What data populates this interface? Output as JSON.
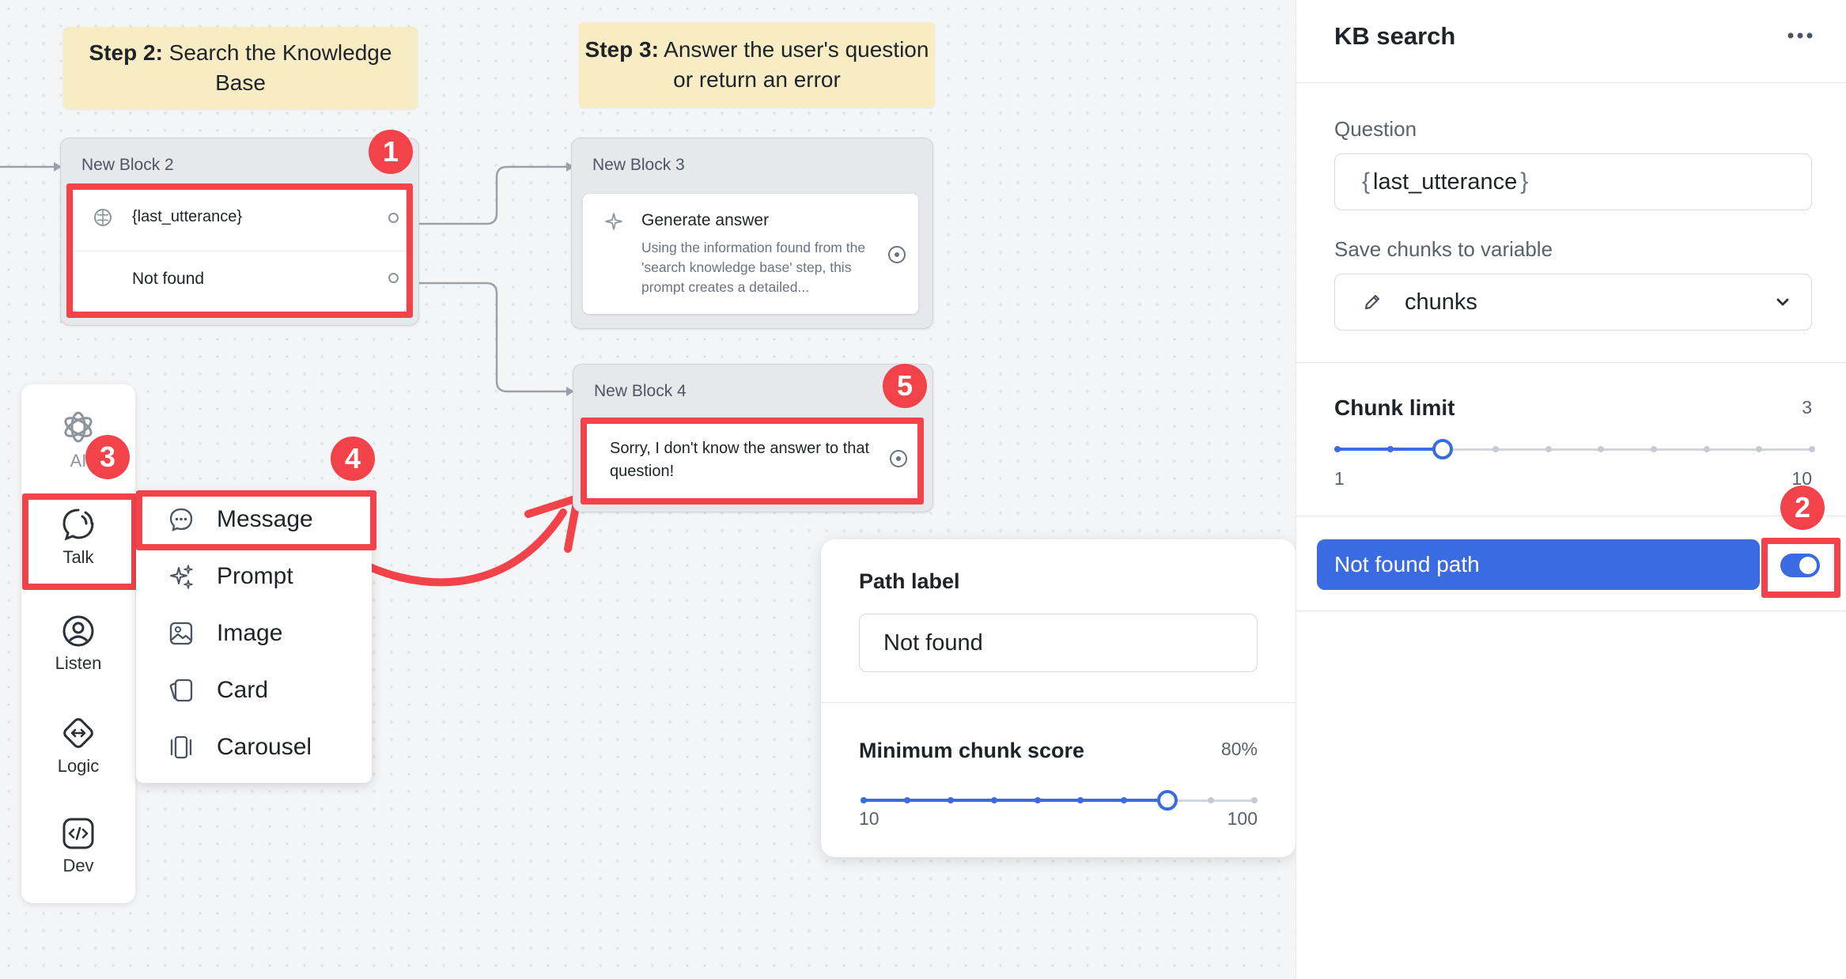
{
  "canvas": {
    "notes": [
      {
        "bold": "Step 2:",
        "text": " Search the Knowledge Base"
      },
      {
        "bold": "Step 3:",
        "text": " Answer the user's question or return an error"
      }
    ],
    "block2": {
      "title": "New Block 2",
      "rows": [
        {
          "label": "{last_utterance}",
          "icon": "brain-icon"
        },
        {
          "label": "Not found"
        }
      ]
    },
    "block3": {
      "title": "New Block 3",
      "step_title": "Generate answer",
      "step_desc": "Using the information found from the 'search knowledge base' step, this prompt creates a detailed..."
    },
    "block4": {
      "title": "New Block 4",
      "message": "Sorry, I don't know the answer to that question!"
    },
    "badges": [
      "1",
      "2",
      "3",
      "4",
      "5"
    ]
  },
  "sidebar": {
    "items": [
      {
        "label": "AI",
        "icon": "openai-icon"
      },
      {
        "label": "Talk",
        "icon": "talk-icon"
      },
      {
        "label": "Listen",
        "icon": "listen-icon"
      },
      {
        "label": "Logic",
        "icon": "logic-icon"
      },
      {
        "label": "Dev",
        "icon": "code-icon"
      }
    ]
  },
  "talk_menu": {
    "items": [
      {
        "label": "Message",
        "icon": "message-icon"
      },
      {
        "label": "Prompt",
        "icon": "sparkle-icon"
      },
      {
        "label": "Image",
        "icon": "image-icon"
      },
      {
        "label": "Card",
        "icon": "card-icon"
      },
      {
        "label": "Carousel",
        "icon": "carousel-icon"
      }
    ]
  },
  "panel": {
    "title": "KB search",
    "more_icon": "more-icon",
    "question_label": "Question",
    "question_value": "last_utterance",
    "save_label": "Save chunks to variable",
    "save_value": "chunks",
    "chunk_limit_label": "Chunk limit",
    "chunk_limit_value": "3",
    "chunk_limit_min": "1",
    "chunk_limit_max": "10",
    "chunk_limit_fraction": 0.222,
    "not_found_label": "Not found path",
    "not_found_enabled": true,
    "accent": "#3b6be0"
  },
  "path_popup": {
    "path_label": "Path label",
    "path_value": "Not found",
    "min_score_label": "Minimum chunk score",
    "min_score_value": "80%",
    "min_score_min": "10",
    "min_score_max": "100",
    "min_score_fraction": 0.778
  }
}
